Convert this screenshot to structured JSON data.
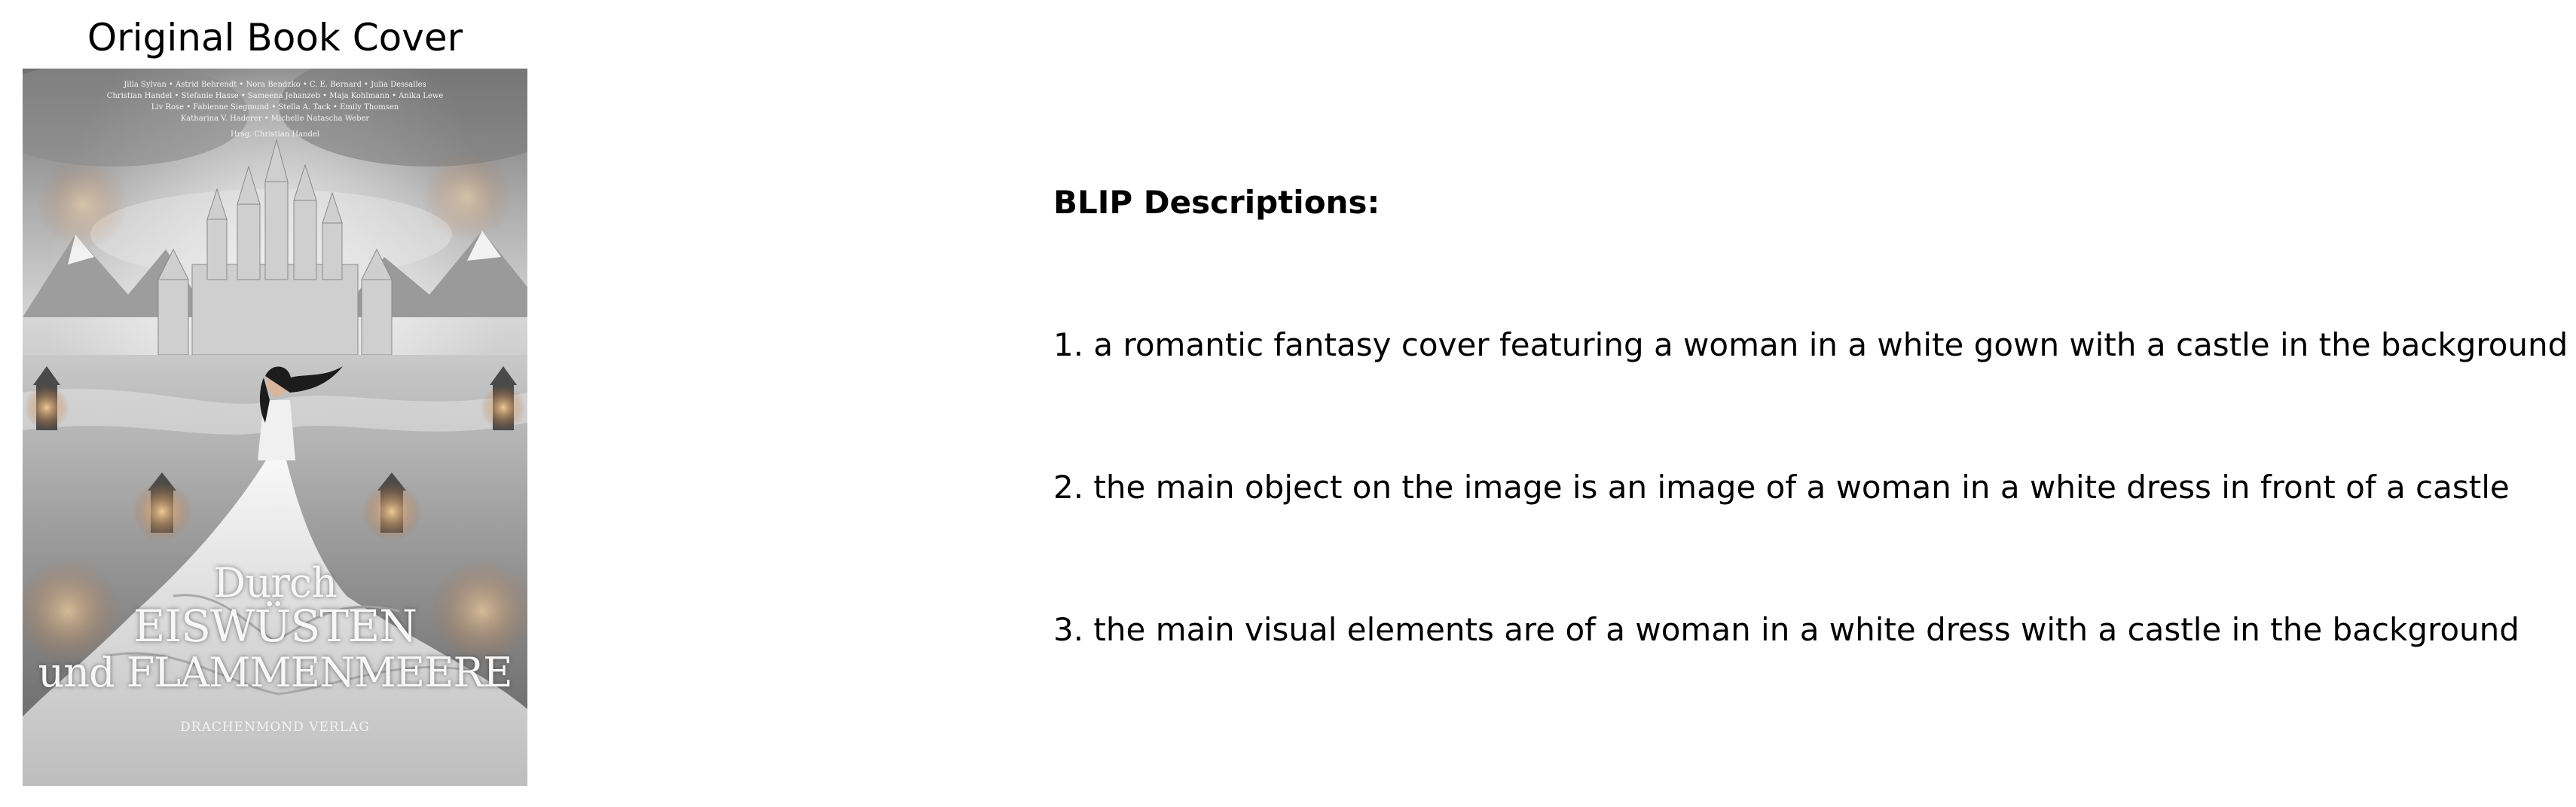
{
  "left_panel": {
    "title": "Original Book Cover",
    "cover": {
      "credit_lines": [
        "Jilla Sylvan • Astrid Behrendt • Nora Bendzko • C. E. Bernard • Julia Dessalles",
        "Christian Handel • Stefanie Hasse • Sameena Jehanzeb • Maja Kohlmann • Anika Lewe",
        "Liv Rose • Fabienne Siegmund • Stella A. Tack • Emily Thomsen",
        "Katharina V. Haderer • Michelle Natascha Weber"
      ],
      "editor_line": "Hrsg. Christian Handel",
      "title_line1": "Durch",
      "title_line2": "EISWÜSTEN",
      "title_line3": "und FLAMMENMEERE",
      "publisher": "DRACHENMOND VERLAG"
    }
  },
  "right_panel": {
    "heading": "BLIP Descriptions:",
    "descriptions": [
      "1. a romantic fantasy cover featuring a woman in a white gown with a castle in the background",
      "2. the main object on the image is an image of a woman in a white dress in front of a castle",
      "3. the main visual elements are of a woman in a white dress with a castle in the background"
    ]
  }
}
